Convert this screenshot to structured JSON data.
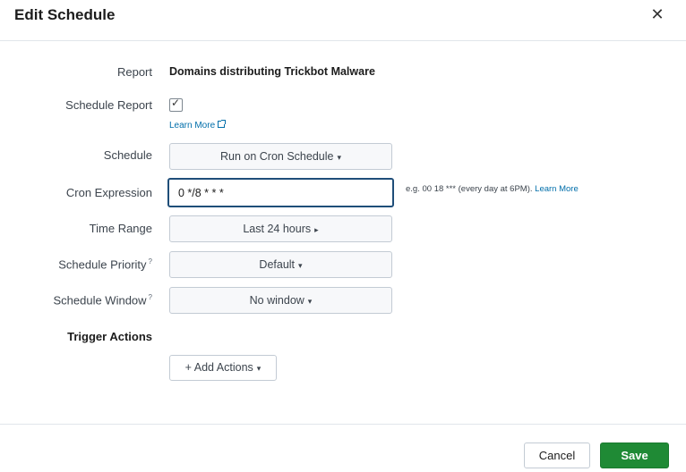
{
  "dialog": {
    "title": "Edit Schedule",
    "close_glyph": "✕"
  },
  "form": {
    "report": {
      "label": "Report",
      "value": "Domains distributing Trickbot Malware"
    },
    "schedule_report": {
      "label": "Schedule Report",
      "checked": true,
      "check_glyph": "✓",
      "learn_more": "Learn More"
    },
    "schedule": {
      "label": "Schedule",
      "value": "Run on Cron Schedule",
      "caret": "▾"
    },
    "cron_expression": {
      "label": "Cron Expression",
      "value": "0 */8 * * *",
      "help_text": "e.g. 00 18 *** (every day at 6PM).",
      "help_link": "Learn More"
    },
    "time_range": {
      "label": "Time Range",
      "value": "Last 24 hours",
      "caret": "▸"
    },
    "schedule_priority": {
      "label": "Schedule Priority",
      "help_mark": "?",
      "value": "Default",
      "caret": "▾"
    },
    "schedule_window": {
      "label": "Schedule Window",
      "help_mark": "?",
      "value": "No window",
      "caret": "▾"
    },
    "trigger_actions": {
      "label": "Trigger Actions",
      "add_label": "+ Add Actions",
      "caret": "▾"
    }
  },
  "footer": {
    "cancel_label": "Cancel",
    "save_label": "Save"
  },
  "colors": {
    "save": "#1f8a35",
    "link": "#006eaa",
    "focus_border": "#1f4e79"
  }
}
